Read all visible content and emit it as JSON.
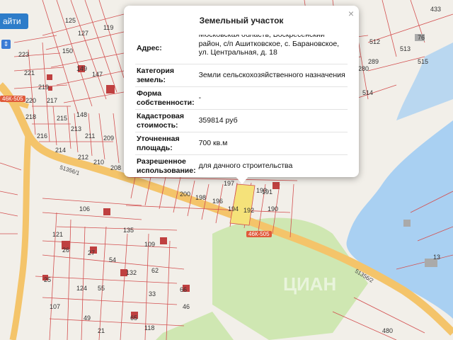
{
  "toolbar": {
    "find_label": "айти",
    "control_icon": "chevron-updown-icon"
  },
  "popup": {
    "title": "Земельный участок",
    "close_label": "×",
    "rows": [
      {
        "key": "Адрес:",
        "value": "Московская область, Воскресенский район, с/п Ашитковское, с. Барановское, ул. Центральная, д. 18"
      },
      {
        "key": "Категория земель:",
        "value": "Земли сельскохозяйственного назначения"
      },
      {
        "key": "Форма собственности:",
        "value": "-"
      },
      {
        "key": "Кадастровая стоимость:",
        "value": "359814 руб"
      },
      {
        "key": "Уточненная площадь:",
        "value": "700 кв.м"
      },
      {
        "key": "Разрешенное использование:",
        "value": "для дачного строительства"
      }
    ]
  },
  "road_labels": {
    "r1": "46К-505",
    "r2": "46К-505",
    "r3": "51356/1",
    "r4": "51356/2"
  },
  "parcel_numbers": {
    "p1": "125",
    "p2": "127",
    "p3": "119",
    "p4": "150",
    "p5": "148",
    "p6": "223",
    "p7": "221",
    "p8": "219",
    "p9": "217",
    "p10": "220",
    "p11": "218",
    "p12": "216",
    "p13": "214",
    "p14": "215",
    "p15": "213",
    "p16": "211",
    "p17": "209",
    "p18": "212",
    "p19": "210",
    "p20": "208",
    "p21": "200",
    "p22": "198",
    "p23": "196",
    "p24": "194",
    "p25": "192",
    "p26": "190",
    "p27": "193",
    "p28": "191",
    "p29": "197",
    "p30": "106",
    "p31": "121",
    "p32": "135",
    "p33": "109",
    "p34": "54",
    "p35": "132",
    "p36": "62",
    "p37": "25",
    "p38": "124",
    "p39": "55",
    "p40": "33",
    "p41": "66",
    "p42": "107",
    "p43": "49",
    "p44": "65",
    "p45": "46",
    "p46": "21",
    "p47": "118",
    "p48": "515",
    "p49": "513",
    "p50": "514",
    "p51": "512",
    "p52": "280",
    "p53": "289",
    "p54": "76",
    "p55": "433",
    "p56": "13",
    "p57": "480",
    "p58": "149",
    "p59": "147",
    "p60": "27",
    "p61": "26"
  },
  "watermark": "ЦИАН"
}
